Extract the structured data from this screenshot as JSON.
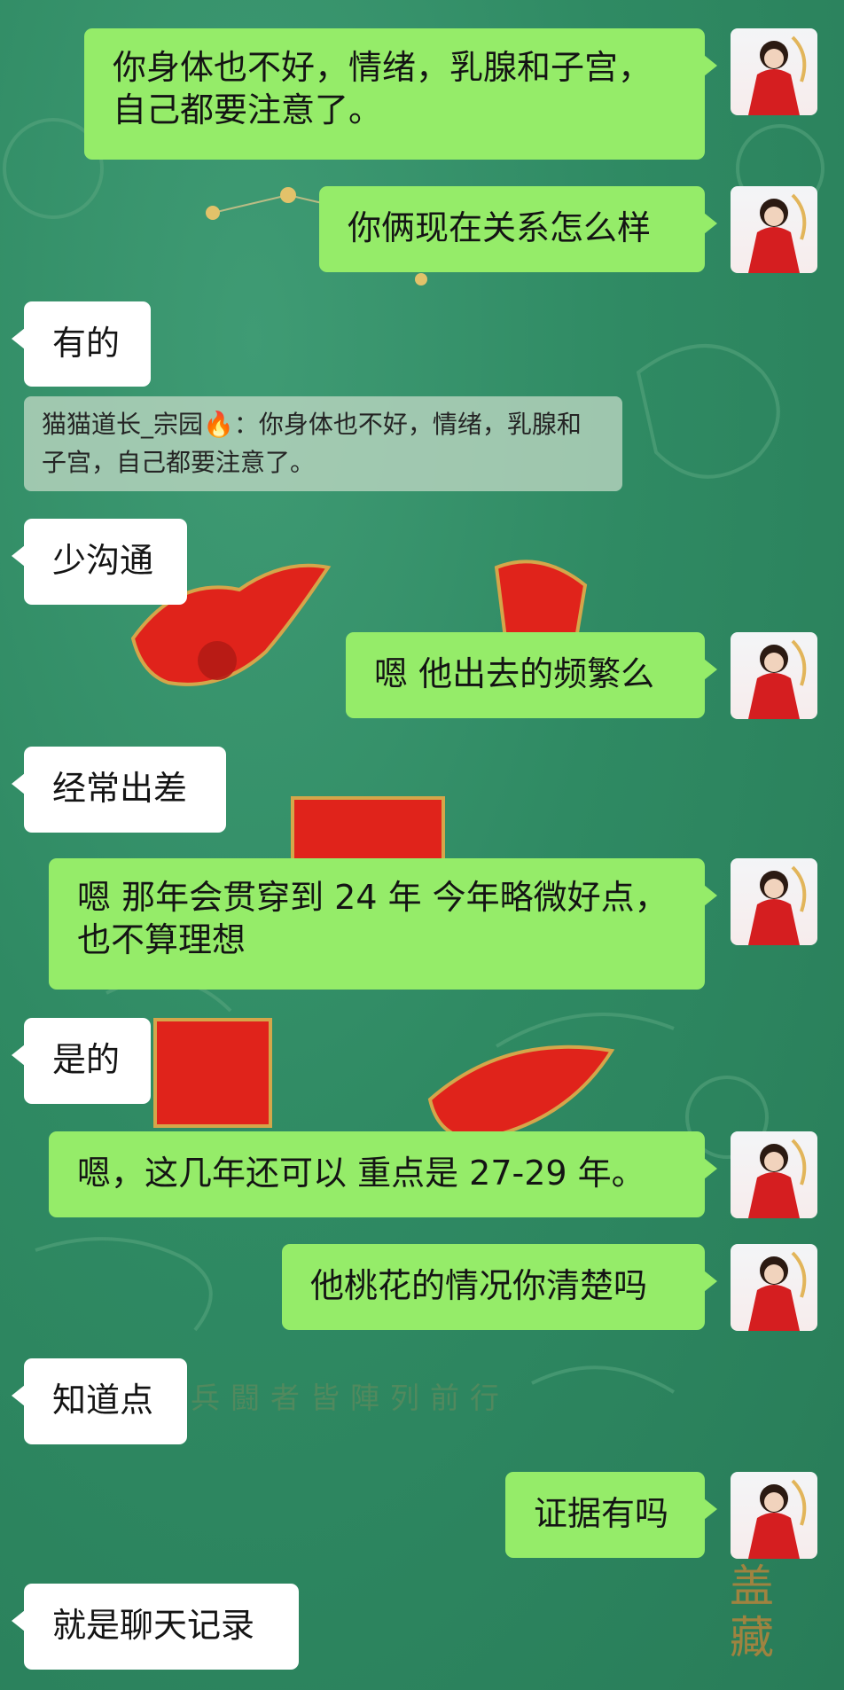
{
  "chat": {
    "messages": [
      {
        "side": "out",
        "text": "你身体也不好，情绪，乳腺和子宫，自己都要注意了。"
      },
      {
        "side": "out",
        "text": "你俩现在关系怎么样"
      },
      {
        "side": "in",
        "text": "有的"
      },
      {
        "side": "in",
        "text": "少沟通"
      },
      {
        "side": "out",
        "text": "嗯 他出去的频繁么"
      },
      {
        "side": "in",
        "text": "经常出差"
      },
      {
        "side": "out",
        "text": "嗯 那年会贯穿到 24 年 今年略微好点，也不算理想"
      },
      {
        "side": "in",
        "text": "是的"
      },
      {
        "side": "out",
        "text": "嗯，这几年还可以 重点是 27-29 年。"
      },
      {
        "side": "out",
        "text": "他桃花的情况你清楚吗"
      },
      {
        "side": "in",
        "text": "知道点"
      },
      {
        "side": "out",
        "text": "证据有吗"
      },
      {
        "side": "in",
        "text": "就是聊天记录"
      }
    ],
    "quote": {
      "text": "猫猫道长_宗园🔥：你身体也不好，情绪，乳腺和子宫，自己都要注意了。"
    }
  },
  "background": {
    "caption": "兵闘者皆陣列前行",
    "seal": "盖藏",
    "accent_color": "#95ec69",
    "red_color": "#e0231b"
  }
}
